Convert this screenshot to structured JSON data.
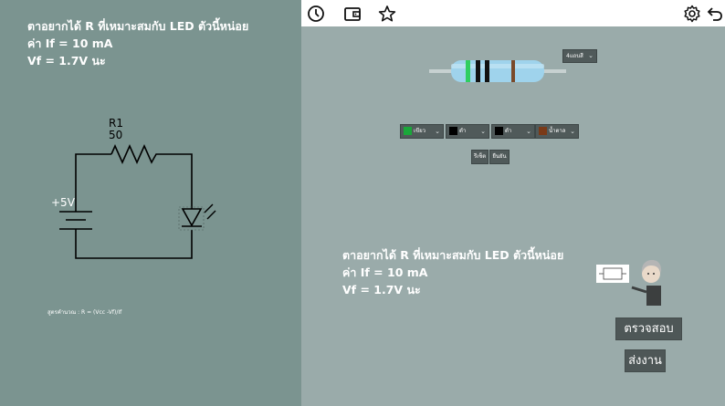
{
  "problem": {
    "line1": "ตาอยากได้ R ที่เหมาะสมกับ LED ตัวนี้หน่อย",
    "line2": "ค่า If = 10 mA",
    "line3": "Vf = 1.7V นะ"
  },
  "circuit": {
    "resistor_name": "R1",
    "resistor_value": "50",
    "source_label": "+5V"
  },
  "formula": "สูตรคำนวณ : R = (Vcc -Vf)/If",
  "toolbar": {
    "icons": [
      "clock-icon",
      "wallet-icon",
      "star-icon",
      "gear-icon",
      "undo-icon"
    ]
  },
  "band_count_select": {
    "value": "4แถบสี"
  },
  "bands": [
    {
      "label": "เขียว",
      "color": "#1aa83a"
    },
    {
      "label": "ดำ",
      "color": "#000000"
    },
    {
      "label": "ดำ",
      "color": "#000000"
    },
    {
      "label": "น้ำตาล",
      "color": "#7a3a18"
    }
  ],
  "resistor_band_colors": [
    "#2fce60",
    "#111111",
    "#111111",
    "#7a4a2a"
  ],
  "buttons": {
    "reset": "รีเซ็ต",
    "confirm": "ยืนยัน",
    "check": "ตรวจสอบ",
    "submit": "ส่งงาน"
  }
}
